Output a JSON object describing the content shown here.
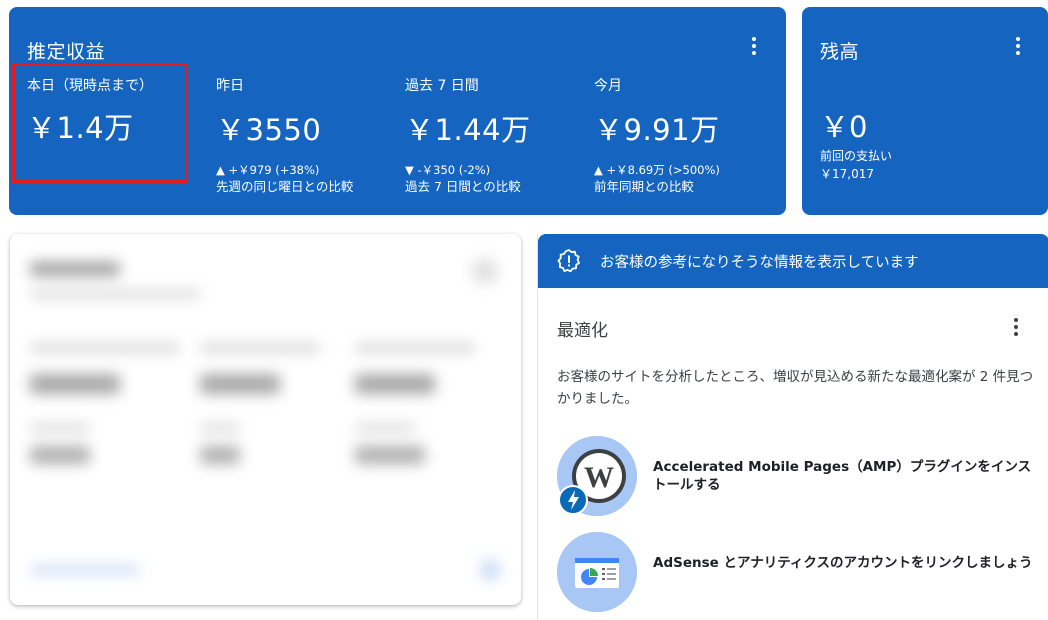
{
  "earnings": {
    "title": "推定収益",
    "metrics": [
      {
        "label": "本日（現時点まで）",
        "value": "￥1.4万",
        "delta": "",
        "compare": ""
      },
      {
        "label": "昨日",
        "value": "￥3550",
        "delta": "▲ +￥979 (+38%)",
        "compare": "先週の同じ曜日との比較"
      },
      {
        "label": "過去 7 日間",
        "value": "￥1.44万",
        "delta": "▼ -￥350 (-2%)",
        "compare": "過去 7 日間との比較"
      },
      {
        "label": "今月",
        "value": "￥9.91万",
        "delta": "▲ +￥8.69万 (>500%)",
        "compare": "前年同期との比較"
      }
    ]
  },
  "balance": {
    "title": "残高",
    "value": "￥0",
    "last_payment_label": "前回の支払い",
    "last_payment_amount": "￥17,017"
  },
  "insights": {
    "header_text": "お客様の参考になりそうな情報を表示しています",
    "title": "最適化",
    "description": "お客様のサイトを分析したところ、増収が見込める新たな最適化案が 2 件見つかりました。",
    "recommendations": [
      {
        "text": "Accelerated Mobile Pages（AMP）プラグインをインストールする",
        "icon": "wordpress-amp-icon"
      },
      {
        "text": "AdSense とアナリティクスのアカウントをリンクしましょう",
        "icon": "analytics-link-icon"
      }
    ]
  },
  "colors": {
    "card_blue": "#1565c0",
    "highlight_red": "#e31b1b"
  }
}
